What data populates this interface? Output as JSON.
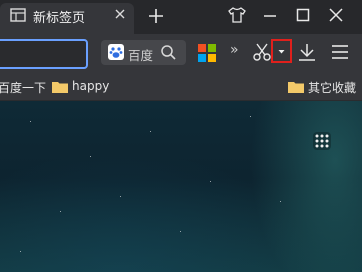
{
  "tab": {
    "title": "新标签页",
    "icon": "tab-page-icon"
  },
  "window_controls": {
    "skin": "shirt-icon",
    "minimize": "minimize-icon",
    "maximize": "maximize-icon",
    "close": "close-icon"
  },
  "toolbar": {
    "search": {
      "text": "百度",
      "engine_icon": "baidu-paw-icon"
    },
    "icons": [
      "apps-icon",
      "scissors-icon",
      "dropdown-caret-icon",
      "download-icon",
      "menu-icon"
    ],
    "more": "»"
  },
  "bookmarks": {
    "items": [
      {
        "label": "百度一下"
      },
      {
        "label": "happy"
      }
    ],
    "other": {
      "label": "其它收藏"
    }
  },
  "colors": {
    "accent": "#6aa0ff",
    "highlight": "#e0201c",
    "folder": "#f3c969"
  }
}
